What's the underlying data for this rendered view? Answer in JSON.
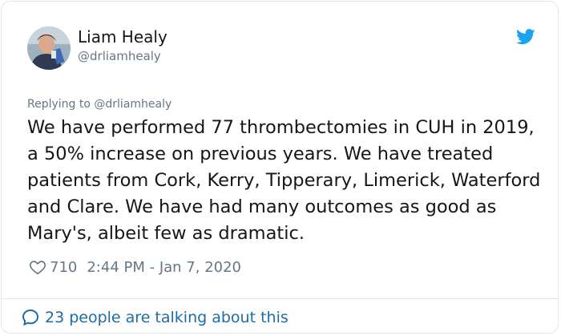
{
  "author": {
    "name": "Liam Healy",
    "handle": "@drliamhealy"
  },
  "reply": {
    "prefix": "Replying to ",
    "handle": "@drliamhealy"
  },
  "tweet": {
    "text": "We have performed 77 thrombectomies in CUH in 2019, a 50% increase on previous years. We have treated patients from Cork, Kerry, Tipperary, Limerick, Waterford and Clare. We have had many outcomes as good as Mary's, albeit few as dramatic."
  },
  "meta": {
    "likes": "710",
    "timestamp": "2:44 PM - Jan 7, 2020"
  },
  "footer": {
    "conversation_label": "23 people are talking about this"
  },
  "icons": {
    "brand": "twitter-bird-icon",
    "like": "heart-icon",
    "conversation": "speech-bubble-icon"
  },
  "colors": {
    "brand_blue": "#1da1f2",
    "secondary_text": "#657786",
    "link_blue": "#1b6ca8",
    "border": "#e1e8ed"
  }
}
